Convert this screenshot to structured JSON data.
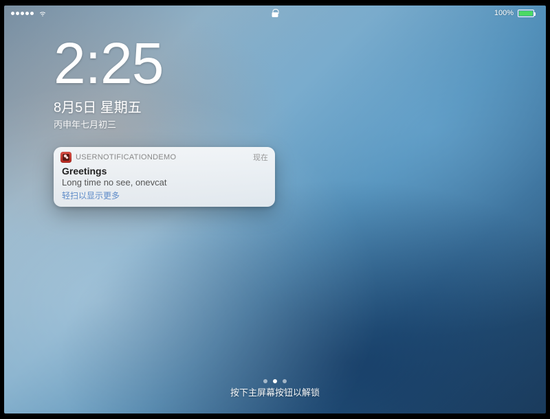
{
  "status": {
    "carrier_signal": 5,
    "battery_percent_label": "100%",
    "battery_fill_pct": 100,
    "bluetooth_glyph": "",
    "bolt_glyph": ""
  },
  "clock": {
    "time": "2:25",
    "date_main": "8月5日 星期五",
    "date_sub": "丙申年七月初三"
  },
  "notification": {
    "app_name": "USERNOTIFICATIONDEMO",
    "time_ago": "现在",
    "title": "Greetings",
    "message": "Long time no see, onevcat",
    "swipe_hint": "轻扫以显示更多"
  },
  "unlock_hint": "按下主屏幕按钮以解锁",
  "pager": {
    "count": 3,
    "active_index": 1
  }
}
